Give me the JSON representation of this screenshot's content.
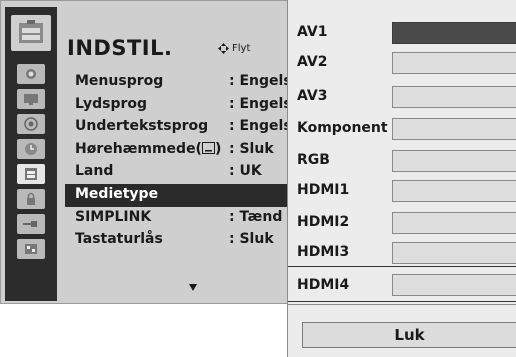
{
  "menu": {
    "title": "INDSTIL.",
    "nav_hint": "Flyt",
    "items": [
      {
        "label": "Menusprog",
        "value": ": Engels"
      },
      {
        "label": "Lydsprog",
        "value": ": Engels"
      },
      {
        "label": "Undertekstsprog",
        "value": ": Engels"
      },
      {
        "label": "Hørehæmmede(",
        "value": ": Sluk"
      },
      {
        "label": "Land",
        "value": ": UK"
      },
      {
        "label": "Medietype",
        "value": ""
      },
      {
        "label": "SIMPLINK",
        "value": ": Tænd"
      },
      {
        "label": "Tastaturlås",
        "value": ": Sluk"
      }
    ]
  },
  "sidebar": {
    "icons": [
      "picture-icon",
      "screen-icon",
      "audio-icon",
      "time-icon",
      "setup-icon",
      "lock-icon",
      "input-icon",
      "usb-icon"
    ]
  },
  "popup": {
    "inputs": [
      "AV1",
      "AV2",
      "AV3",
      "Komponent",
      "RGB",
      "HDMI1",
      "HDMI2",
      "HDMI3",
      "HDMI4"
    ],
    "close_label": "Luk"
  }
}
